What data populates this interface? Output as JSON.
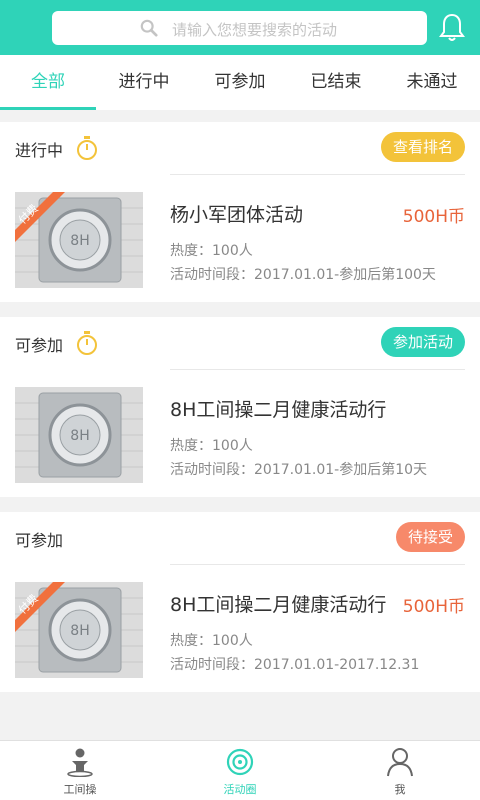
{
  "search": {
    "placeholder": "请输入您想要搜索的活动"
  },
  "icons": {
    "search": "search-icon",
    "bell": "bell-icon",
    "timer": "timer-icon"
  },
  "tabs": [
    {
      "label": "全部",
      "active": true
    },
    {
      "label": "进行中"
    },
    {
      "label": "可参加"
    },
    {
      "label": "已结束"
    },
    {
      "label": "未通过"
    }
  ],
  "colors": {
    "brand": "#2fd3b8",
    "yellow": "#f3c33a",
    "orange": "#f7896a",
    "price": "#e8643a"
  },
  "cards": [
    {
      "status": "进行中",
      "button": "查看排名",
      "button_color": "#f3c33a",
      "badge": "付费",
      "title": "杨小军团体活动",
      "price": "500H币",
      "heat": "热度：100人",
      "period": "活动时间段：2017.01.01-参加后第100天"
    },
    {
      "status": "可参加",
      "button": "参加活动",
      "button_color": "#2fd3b8",
      "title": "8H工间操二月健康活动行",
      "heat": "热度：100人",
      "period": "活动时间段：2017.01.01-参加后第10天"
    },
    {
      "status": "可参加",
      "button": "待接受",
      "button_color": "#f7896a",
      "badge": "付费",
      "title": "8H工间操二月健康活动行",
      "price": "500H币",
      "heat": "热度：100人",
      "period": "活动时间段：2017.01.01-2017.12.31"
    }
  ],
  "nav": [
    {
      "label": "工间操"
    },
    {
      "label": "活动圈",
      "active": true
    },
    {
      "label": "我"
    }
  ]
}
